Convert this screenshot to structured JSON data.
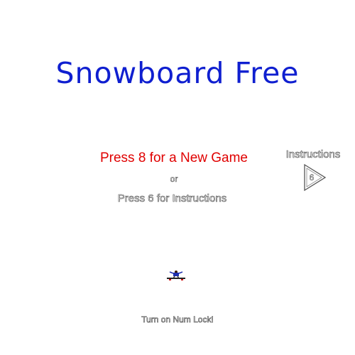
{
  "game": {
    "title": "Snowboard Free",
    "new_game_prompt": "Press 8 for a New Game",
    "or_text": "or",
    "instructions_prompt": "Press 6 for Instructions",
    "instructions_label": "Instructions",
    "instructions_key": "6",
    "numlock_hint": "Turn on Num Lock!"
  },
  "colors": {
    "title": "#0f1fd0",
    "new_game_prompt": "#e00000",
    "outline_text": "#444444",
    "background": "#ffffff"
  },
  "icons": {
    "instructions_button": "right-arrow-icon",
    "player_sprite": "snowboarder-icon"
  }
}
